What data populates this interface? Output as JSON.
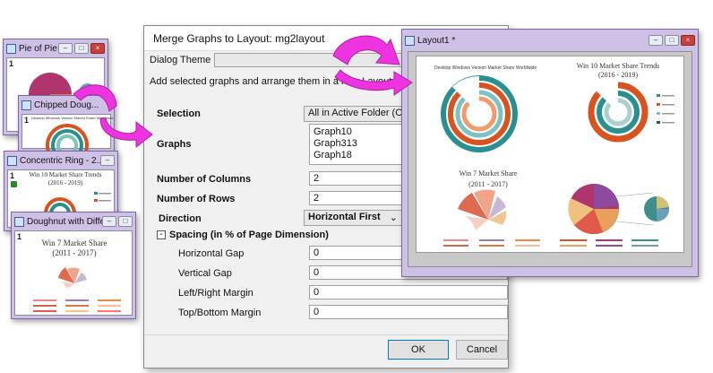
{
  "windows": {
    "pie_of_pie": {
      "title": "Pie of Pie",
      "page": "1"
    },
    "chipped": {
      "title": "Chipped Doug...",
      "page": "1",
      "chart_title": "Desktop Windows Version Market Share Worldwide"
    },
    "concentric": {
      "title": "Concentric Ring - 2...",
      "page": "1",
      "chart_title_1": "Win 10 Market Share Trends",
      "chart_title_2": "(2016 - 2019)"
    },
    "doughnut": {
      "title": "Doughnut with Differe...",
      "page": "1",
      "chart_title_1": "Win 7 Market Share",
      "chart_title_2": "(2011 - 2017)"
    }
  },
  "dialog": {
    "title": "Merge Graphs to Layout: mg2layout",
    "theme_label": "Dialog Theme",
    "description": "Add selected graphs and arrange them in a new Layout",
    "selection_label": "Selection",
    "selection_value": "All in Active Folder (Op",
    "graphs_label": "Graphs",
    "graphs": [
      "Graph10",
      "Graph313",
      "Graph18"
    ],
    "columns_label": "Number of Columns",
    "columns_value": "2",
    "rows_label": "Number of Rows",
    "rows_value": "2",
    "direction_label": "Direction",
    "direction_value": "Horizontal First",
    "spacing_label": "Spacing (in % of Page Dimension)",
    "hgap_label": "Horizontal Gap",
    "hgap_value": "0",
    "vgap_label": "Vertical Gap",
    "vgap_value": "0",
    "lr_label": "Left/Right Margin",
    "lr_value": "0",
    "tb_label": "Top/Bottom Margin",
    "tb_value": "0",
    "ok": "OK",
    "cancel": "Cancel"
  },
  "layout": {
    "title": "Layout1 *",
    "g1_title": "Desktop Windows Version Market Share Worldwide",
    "g2_title_1": "Win 10 Market Share Trends",
    "g2_title_2": "(2016 - 2019)",
    "g3_title_1": "Win 7 Market Share",
    "g3_title_2": "(2011 - 2017)"
  },
  "colors": {
    "window_frame": "#cfc0e6",
    "arrow": "#ee33e0",
    "teal": "#2a8f8f",
    "orange": "#d9531e"
  },
  "icons": {
    "minimize": "minimize-icon",
    "maximize": "maximize-icon",
    "close": "close-icon",
    "collapse": "minus-box-icon",
    "dropdown": "chevron-down-icon"
  }
}
